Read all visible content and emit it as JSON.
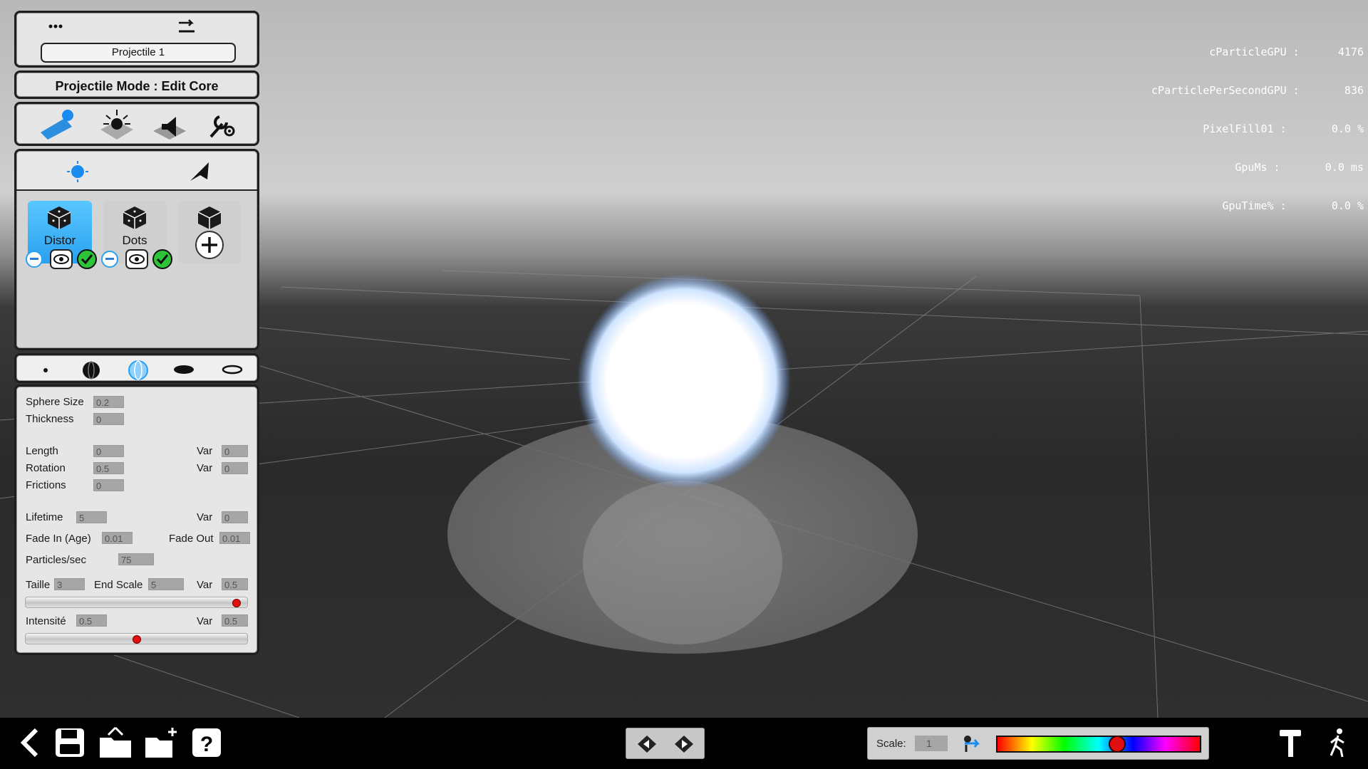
{
  "window": {
    "projectile_name": "Projectile 1",
    "mode_label": "Projectile Mode : Edit Core"
  },
  "toolbar": {
    "top_icons": [
      "menu-dots-icon",
      "undo-arrow-icon"
    ],
    "tools": [
      "projectile-edit-icon",
      "light-burst-icon",
      "sound-speaker-icon",
      "settings-wrench-icon"
    ],
    "sub_tools": [
      "core-particle-icon",
      "shape-arrow-icon"
    ]
  },
  "layers": [
    {
      "label": "Distor",
      "active": true
    },
    {
      "label": "Dots",
      "active": false
    },
    {
      "label": "",
      "add": true
    }
  ],
  "shape_tabs": [
    "point-shape-icon",
    "sphere-shape-icon",
    "sphere-shell-icon",
    "disc-shape-icon",
    "ring-shape-icon"
  ],
  "props": {
    "sphere_size": {
      "label": "Sphere Size",
      "value": "0.2"
    },
    "thickness": {
      "label": "Thickness",
      "value": "0"
    },
    "length": {
      "label": "Length",
      "value": "0",
      "var_label": "Var",
      "var": "0"
    },
    "rotation": {
      "label": "Rotation",
      "value": "0.5",
      "var_label": "Var",
      "var": "0"
    },
    "frictions": {
      "label": "Frictions",
      "value": "0"
    },
    "lifetime": {
      "label": "Lifetime",
      "value": "5",
      "var_label": "Var",
      "var": "0"
    },
    "fade_in": {
      "label": "Fade In (Age)",
      "value": "0.01"
    },
    "fade_out": {
      "label": "Fade Out",
      "value": "0.01"
    },
    "particles": {
      "label": "Particles/sec",
      "value": "75"
    },
    "taille": {
      "label": "Taille",
      "value": "3"
    },
    "end_scale": {
      "label": "End Scale",
      "value": "5",
      "var_label": "Var",
      "var": "0.5"
    },
    "taille_slider": 0.97,
    "intensite": {
      "label": "Intensité",
      "value": "0.5",
      "var_label": "Var",
      "var": "0.5"
    },
    "intensite_slider": 0.5
  },
  "stats": {
    "lines": [
      "cParticleGPU :      4176",
      "cParticlePerSecondGPU :       836",
      "PixelFill01 :       0.0 %",
      "GpuMs :       0.0 ms",
      "GpuTime% :       0.0 %"
    ]
  },
  "bottom": {
    "scale_label": "Scale:",
    "scale_value": "1",
    "color_slider": 0.6,
    "icons": [
      "back-chevron-icon",
      "save-disk-icon",
      "export-folder-icon",
      "new-folder-icon",
      "help-icon",
      "prev-nav-icon",
      "next-nav-icon",
      "scale-axis-icon",
      "hammer-icon",
      "walk-person-icon"
    ]
  },
  "colors": {
    "accent": "#2aa1f0",
    "knob": "#e01010",
    "panel_bg": "#e6e6e6"
  }
}
